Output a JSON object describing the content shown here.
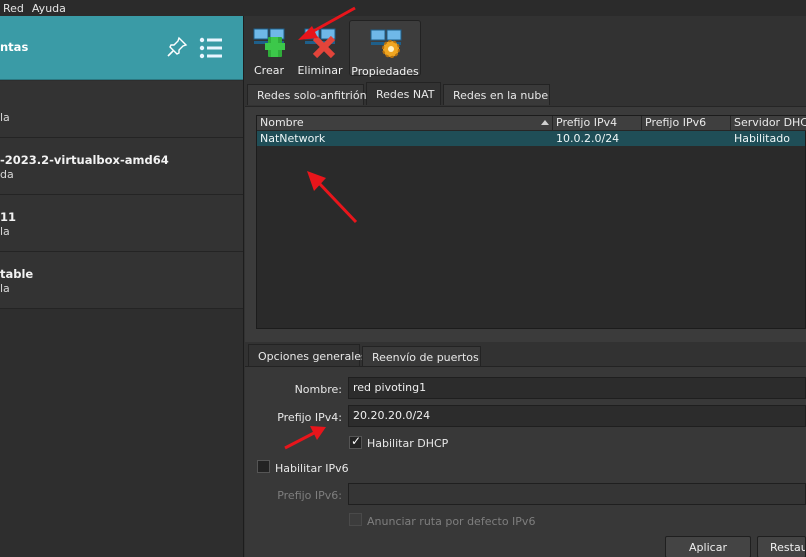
{
  "menubar": {
    "items": [
      "Red",
      "Ayuda"
    ]
  },
  "sidebar": {
    "tools_title": "ntas",
    "vms": [
      {
        "name": "",
        "state": "la"
      },
      {
        "name": "-2023.2-virtualbox-amd64",
        "state": "da"
      },
      {
        "name": "11",
        "state": "la"
      },
      {
        "name": "table",
        "state": "la"
      }
    ]
  },
  "toolbar": {
    "create_label": "Crear",
    "delete_label": "Eliminar",
    "properties_label": "Propiedades"
  },
  "tabs": {
    "host_only": "Redes solo-anfitrión",
    "nat": "Redes NAT",
    "cloud": "Redes en la nube"
  },
  "table": {
    "columns": [
      "Nombre",
      "Prefijo IPv4",
      "Prefijo IPv6",
      "Servidor DHCP"
    ],
    "rows": [
      {
        "name": "NatNetwork",
        "ipv4": "10.0.2.0/24",
        "ipv6": "",
        "dhcp": "Habilitado"
      }
    ]
  },
  "form_tabs": {
    "general": "Opciones generales",
    "port_forwarding": "Reenvío de puertos"
  },
  "form": {
    "name_label": "Nombre:",
    "name_value": "red pivoting1",
    "ipv4_label": "Prefijo IPv4:",
    "ipv4_value": "20.20.20.0/24",
    "dhcp_label": "Habilitar DHCP",
    "dhcp_checked": true,
    "ipv6_enable_label": "Habilitar IPv6",
    "ipv6_prefix_label": "Prefijo IPv6:",
    "ipv6_prefix_value": "",
    "default_route_label": "Anunciar ruta por defecto IPv6"
  },
  "buttons": {
    "apply": "Aplicar",
    "restore": "Restau"
  },
  "colors": {
    "tools_header": "#3a9ba6",
    "selected_row": "#1f4e57",
    "annotation_arrow": "#e8151b"
  }
}
